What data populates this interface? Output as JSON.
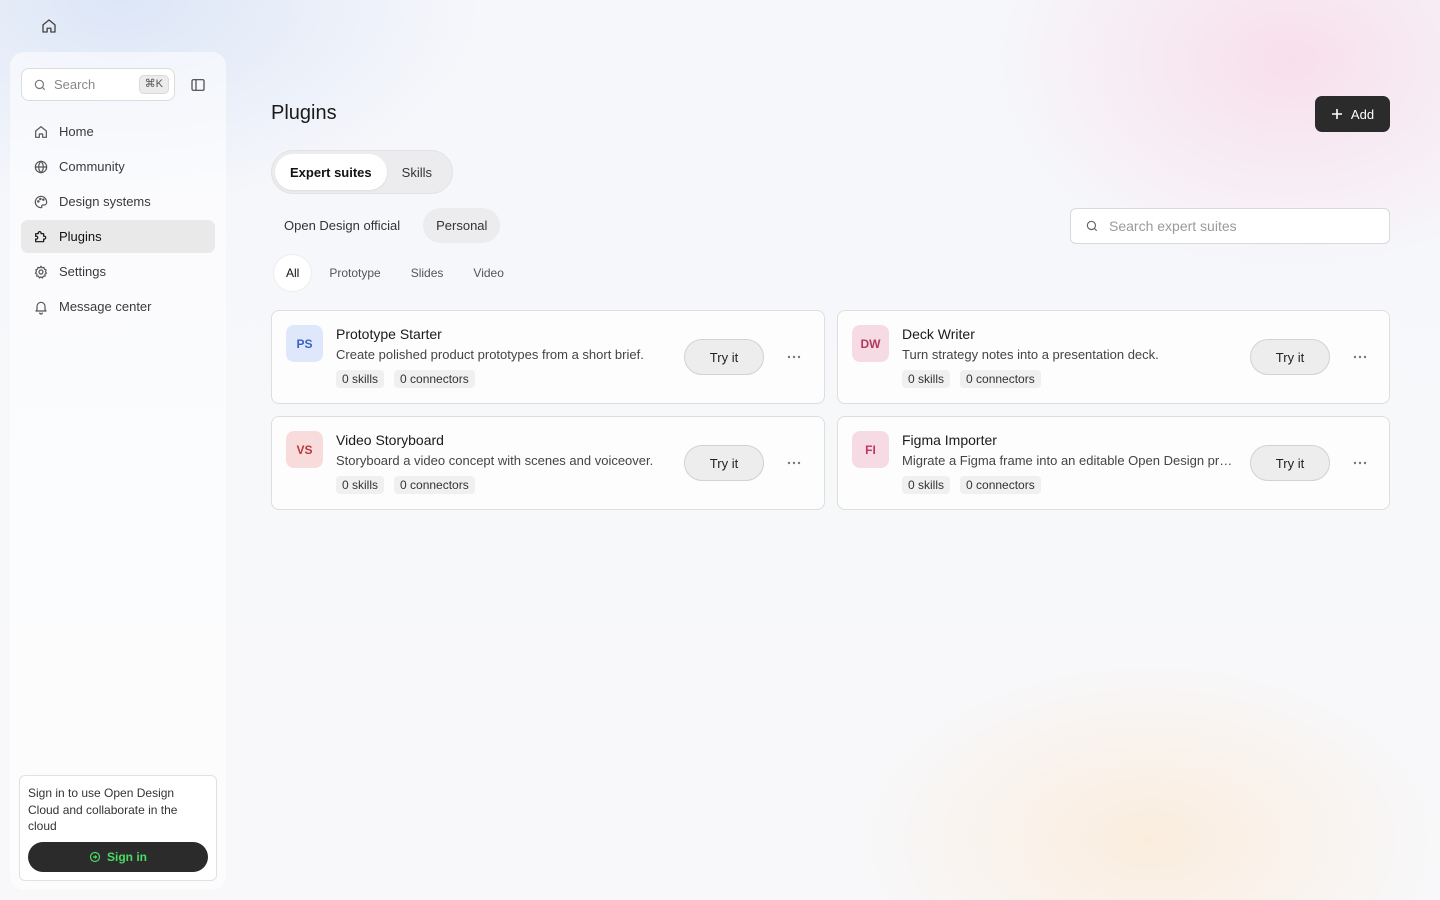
{
  "sidebar": {
    "search_label": "Search",
    "search_shortcut": "⌘K",
    "items": [
      {
        "label": "Home",
        "icon": "home-icon"
      },
      {
        "label": "Community",
        "icon": "globe-icon"
      },
      {
        "label": "Design systems",
        "icon": "palette-icon"
      },
      {
        "label": "Plugins",
        "icon": "puzzle-icon",
        "active": true
      },
      {
        "label": "Settings",
        "icon": "gear-icon"
      },
      {
        "label": "Message center",
        "icon": "bell-icon"
      }
    ],
    "signin_text": "Sign in to use Open Design Cloud and collaborate in the cloud",
    "signin_button": "Sign in"
  },
  "header": {
    "title": "Plugins",
    "add_label": "Add"
  },
  "segments": [
    "Expert suites",
    "Skills"
  ],
  "source_tabs": [
    "Open Design official",
    "Personal"
  ],
  "search": {
    "placeholder": "Search expert suites"
  },
  "categories": [
    "All",
    "Prototype",
    "Slides",
    "Video"
  ],
  "cards": [
    {
      "initials": "PS",
      "title": "Prototype Starter",
      "description": "Create polished product prototypes from a short brief.",
      "skills": "0 skills",
      "connectors": "0 connectors",
      "action": "Try it",
      "badge_bg": "#dfe8fb",
      "badge_fg": "#3b63c4"
    },
    {
      "initials": "DW",
      "title": "Deck Writer",
      "description": "Turn strategy notes into a presentation deck.",
      "skills": "0 skills",
      "connectors": "0 connectors",
      "action": "Try it",
      "badge_bg": "#f7dbe4",
      "badge_fg": "#b23a5e"
    },
    {
      "initials": "VS",
      "title": "Video Storyboard",
      "description": "Storyboard a video concept with scenes and voiceover.",
      "skills": "0 skills",
      "connectors": "0 connectors",
      "action": "Try it",
      "badge_bg": "#f8dcdc",
      "badge_fg": "#b83a3a"
    },
    {
      "initials": "FI",
      "title": "Figma Importer",
      "description": "Migrate a Figma frame into an editable Open Design prototype.",
      "skills": "0 skills",
      "connectors": "0 connectors",
      "action": "Try it",
      "badge_bg": "#f7dbe4",
      "badge_fg": "#c2336a"
    }
  ]
}
